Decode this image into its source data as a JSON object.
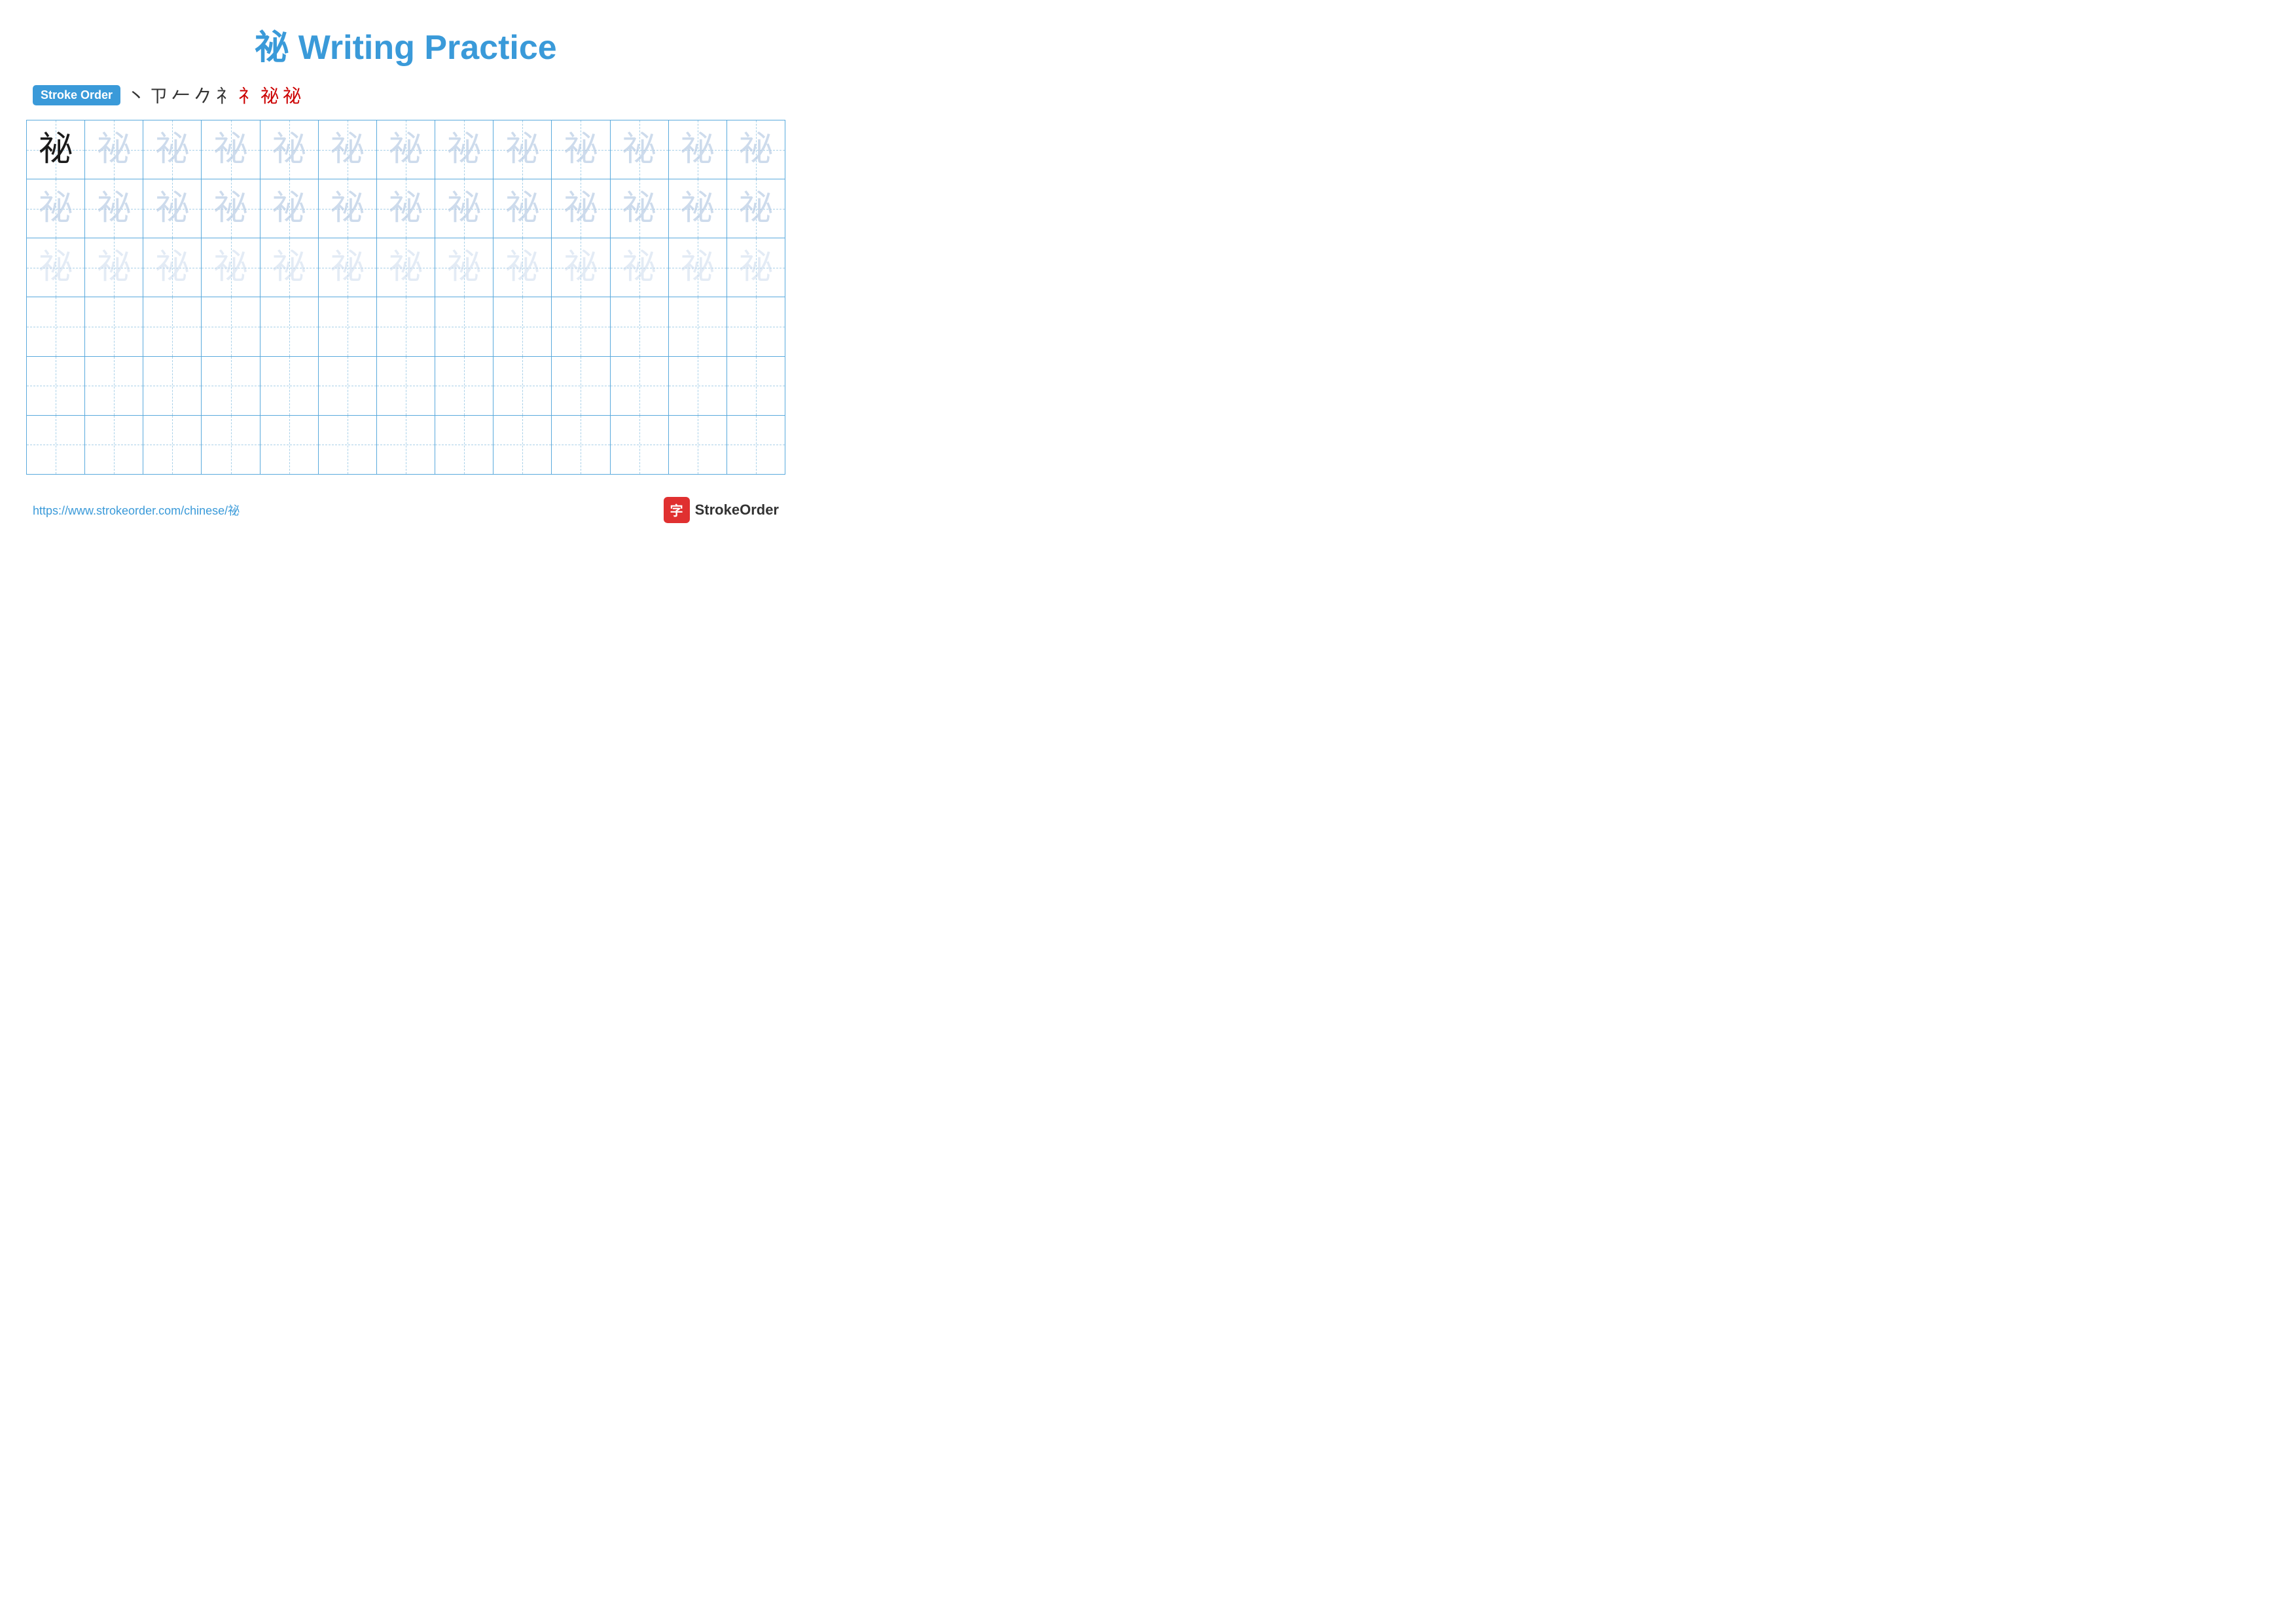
{
  "title": {
    "char": "祕",
    "label": "Writing Practice"
  },
  "stroke_order": {
    "badge": "Stroke Order",
    "steps": [
      "丶",
      "ノ",
      "𠂉",
      "𠂉̄",
      "礻",
      "礻̄",
      "祕",
      "祕"
    ]
  },
  "grid": {
    "rows": 6,
    "cols": 13,
    "char": "祕",
    "row_styles": [
      "dark-then-light1",
      "light1",
      "light2",
      "empty",
      "empty",
      "empty"
    ]
  },
  "footer": {
    "url": "https://www.strokeorder.com/chinese/祕",
    "logo_text": "StrokeOrder",
    "logo_char": "字"
  }
}
